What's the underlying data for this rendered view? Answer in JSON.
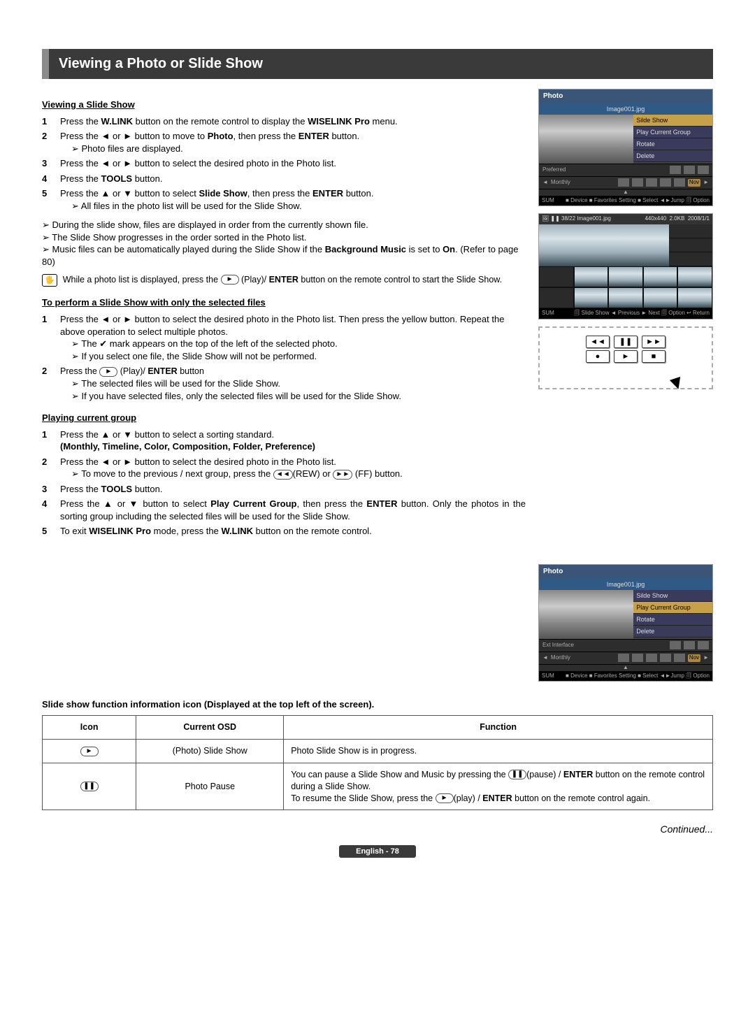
{
  "title": "Viewing a Photo or Slide Show",
  "sections": {
    "vss": {
      "heading": "Viewing a Slide Show",
      "steps": [
        {
          "n": "1",
          "pre": "Press the ",
          "b1": "W.LINK",
          "mid": " button on the remote control to display the ",
          "b2": "WISELINK Pro",
          "post": " menu."
        },
        {
          "n": "2",
          "text": "Press the ◄ or ► button to move to ",
          "b1": "Photo",
          "mid": ", then press the ",
          "b2": "ENTER",
          "post": " button.",
          "sub": [
            "Photo files are displayed."
          ]
        },
        {
          "n": "3",
          "text": "Press the ◄ or ► button to select the desired photo in the Photo list."
        },
        {
          "n": "4",
          "pre": "Press the ",
          "b1": "TOOLS",
          "post": " button."
        },
        {
          "n": "5",
          "text": "Press the ▲ or ▼ button to select ",
          "b1": "Slide Show",
          "mid": ", then press the ",
          "b2": "ENTER",
          "post": " button.",
          "sub": [
            "All files in the photo list will be used for the Slide Show."
          ]
        }
      ],
      "notes_after": [
        "During the slide show, files are displayed in order from the currently shown file.",
        "The Slide Show progresses in the order sorted in the Photo list."
      ],
      "music_note_pre": "Music files can be automatically played during the Slide Show if the ",
      "music_note_b1": "Background Music",
      "music_note_mid": " is set to ",
      "music_note_b2": "On",
      "music_note_post": ". (Refer to page 80)",
      "callout_pre": "While a photo list is displayed, press the ",
      "callout_mid": " (Play)/ ",
      "callout_b": "ENTER",
      "callout_post": " button on the remote control to start the Slide Show."
    },
    "selected": {
      "heading": "To perform a Slide Show with only the selected files",
      "step1": "Press the ◄ or ► button to select the desired photo in the Photo list. Then press the yellow button. Repeat the above operation to select multiple photos.",
      "step1_subs": [
        "The ✔ mark appears on the top of the left of the selected photo.",
        "If you select one file, the Slide Show will not be performed."
      ],
      "step2_pre": "Press the ",
      "step2_mid": " (Play)/ ",
      "step2_b": "ENTER",
      "step2_post": " button",
      "step2_subs": [
        "The selected files will be used for the Slide Show.",
        "If you have selected files, only the selected files will be used for the Slide Show."
      ]
    },
    "current": {
      "heading": "Playing current group",
      "step1_pre": "Press the ▲ or ▼ button to select a sorting standard.",
      "step1_b": "(Monthly, Timeline, Color, Composition, Folder, Preference)",
      "step2_text": "Press the ◄ or ► button to select the desired photo in the Photo list.",
      "step2_sub_pre": "To move to the previous / next group, press  the ",
      "step2_sub_mid": "(REW) or ",
      "step2_sub_post": " (FF) button.",
      "step3_pre": "Press the ",
      "step3_b": "TOOLS",
      "step3_post": " button.",
      "step4_pre": "Press the ▲ or ▼ button to select ",
      "step4_b1": "Play Current Group",
      "step4_mid": ", then press the ",
      "step4_b2": "ENTER",
      "step4_post": " button. Only the photos in the sorting group including the selected files will be used for the Slide Show.",
      "step5_pre": "To exit ",
      "step5_b1": "WISELINK Pro",
      "step5_mid": " mode, press the ",
      "step5_b2": "W.LINK",
      "step5_post": " button on the remote control."
    },
    "table": {
      "heading": "Slide show function information icon (Displayed at the top left of the screen).",
      "headers": {
        "icon": "Icon",
        "osd": "Current OSD",
        "func": "Function"
      },
      "rows": [
        {
          "osd": "(Photo) Slide Show",
          "func": "Photo Slide Show is in progress.",
          "icon": "►"
        },
        {
          "osd": "Photo Pause",
          "func_pre": "You can pause a Slide Show and Music by pressing the ",
          "func_mid1": "(pause) / ",
          "func_b1": "ENTER",
          "func_mid2": " button on the remote control during a Slide Show.",
          "func_line2_pre": "To resume the Slide Show, press the ",
          "func_line2_mid": "(play) / ",
          "func_line2_b": "ENTER",
          "func_line2_post": " button on the remote control again.",
          "icon": "❚❚"
        }
      ]
    }
  },
  "screens": {
    "photo": {
      "title": "Photo",
      "file": "Image001.jpg",
      "menu": [
        "Silde Show",
        "Play Current Group",
        "Rotate",
        "Delete"
      ],
      "strip_left": "Preferred",
      "monthly": "Monthly",
      "now": "Nov",
      "sum": "SUM",
      "foot": "■ Device  ■ Favorites Setting  ■ Select  ◄►Jump  🗐 Option"
    },
    "full": {
      "info_l": "38/22",
      "file": "Image001.jpg",
      "res": "440x440",
      "size": "2.0KB",
      "date": "2008/1/1",
      "sum": "SUM",
      "foot": "🗐 Slide Show  ◄ Previous  ► Next  🗐 Option  ↩ Return"
    },
    "photo2": {
      "title": "Photo",
      "file": "Image001.jpg",
      "menu": [
        "Silde Show",
        "Play Current Group",
        "Rotate",
        "Delete"
      ],
      "monthly": "Monthly",
      "now": "Nov",
      "sum": "SUM",
      "foot": "■ Device  ■ Favorites Setting  ■ Select  ◄►Jump  🗐 Option"
    }
  },
  "remote_buttons": [
    "◄◄",
    "❚❚",
    "►►",
    "●",
    "►",
    "■"
  ],
  "continued": "Continued...",
  "footer": "English - 78"
}
